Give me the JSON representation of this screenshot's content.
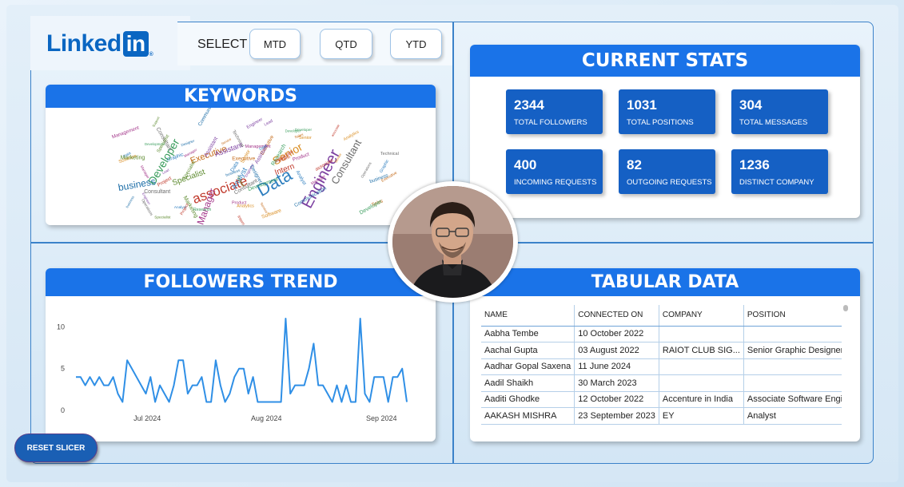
{
  "logo": {
    "text": "Linked",
    "box": "in"
  },
  "select": {
    "label": "SELECT",
    "buttons": [
      "MTD",
      "QTD",
      "YTD"
    ]
  },
  "keywords": {
    "title": "KEYWORDS",
    "words": [
      "Engineer",
      "Data",
      "associate",
      "Developer",
      "Senior",
      "Consultant",
      "Manager",
      "business",
      "Specialist",
      "Executive",
      "Assistant",
      "Analyst",
      "Intern",
      "Development",
      "Software",
      "Technical",
      "Product",
      "Designer",
      "Marketing",
      "Sales",
      "Lead",
      "Graphic",
      "Project",
      "Research",
      "Analytics",
      "Operations",
      "Management",
      "Communication",
      "Support",
      "Service"
    ]
  },
  "stats": {
    "title": "CURRENT STATS",
    "items": [
      {
        "value": "2344",
        "label": "TOTAL FOLLOWERS"
      },
      {
        "value": "1031",
        "label": "TOTAL POSITIONS"
      },
      {
        "value": "304",
        "label": "TOTAL MESSAGES"
      },
      {
        "value": "400",
        "label": "INCOMING REQUESTS"
      },
      {
        "value": "82",
        "label": "OUTGOING REQUESTS"
      },
      {
        "value": "1236",
        "label": "DISTINCT COMPANY"
      }
    ]
  },
  "followers_trend": {
    "title": "FOLLOWERS TREND"
  },
  "chart_data": {
    "type": "line",
    "title": "FOLLOWERS TREND",
    "xlabel": "",
    "ylabel": "",
    "ylim": [
      0,
      11
    ],
    "y_ticks": [
      "0",
      "5",
      "10"
    ],
    "x_tick_labels": [
      "Jul 2024",
      "Aug 2024",
      "Sep 2024"
    ],
    "series": [
      {
        "values": [
          4,
          4,
          3,
          4,
          3,
          4,
          3,
          3,
          4,
          2,
          1,
          6,
          5,
          4,
          3,
          2,
          4,
          1,
          3,
          2,
          1,
          3,
          6,
          6,
          2,
          3,
          3,
          4,
          1,
          1,
          6,
          3,
          1,
          2,
          4,
          5,
          5,
          2,
          4,
          1,
          1,
          1,
          1,
          1,
          1,
          11,
          2,
          3,
          3,
          3,
          5,
          8,
          3,
          3,
          2,
          1,
          3,
          1,
          3,
          1,
          1,
          11,
          2,
          1,
          4,
          4,
          4,
          1,
          4,
          4,
          5,
          1
        ]
      }
    ],
    "line_color": "#2f8fe6"
  },
  "tabular": {
    "title": "TABULAR DATA",
    "columns": [
      "NAME",
      "CONNECTED ON",
      "COMPANY",
      "POSITION"
    ],
    "rows": [
      [
        "Aabha Tembe",
        "10 October 2022",
        "",
        ""
      ],
      [
        "Aachal Gupta",
        "03 August 2022",
        "RAIOT CLUB SIG...",
        "Senior Graphic Designer"
      ],
      [
        "Aadhar Gopal Saxena",
        "11 June 2024",
        "",
        ""
      ],
      [
        "Aadil Shaikh",
        "30 March 2023",
        "",
        ""
      ],
      [
        "Aaditi Ghodke",
        "12 October 2022",
        "Accenture in India",
        "Associate Software Engi..."
      ],
      [
        "AAKASH MISHRA",
        "23 September 2023",
        "EY",
        "Analyst"
      ]
    ]
  },
  "reset": {
    "label": "RESET SLICER"
  },
  "colors": {
    "accent": "#1a73e8",
    "stat_box": "#1560c4",
    "border": "#3b82c9"
  }
}
